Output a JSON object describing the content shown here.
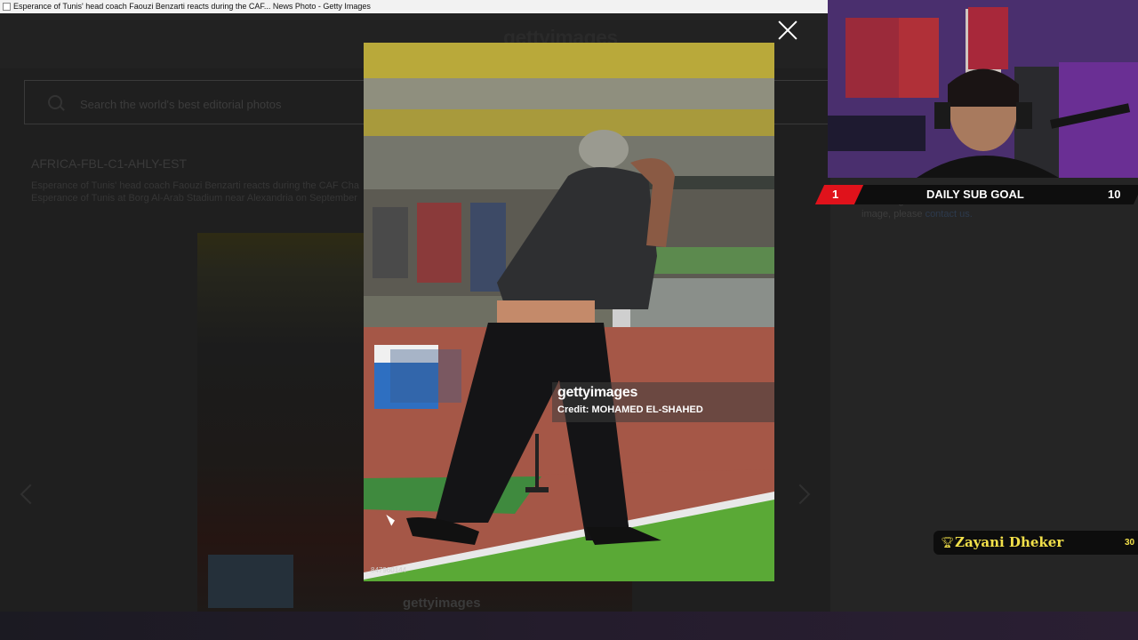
{
  "window": {
    "title": "Esperance of Tunis' head coach Faouzi Benzarti reacts during the CAF... News Photo - Getty Images"
  },
  "page": {
    "logo": "gettyimages",
    "search": {
      "placeholder": "Search the world's best editorial photos"
    },
    "photo_title": "AFRICA-FBL-C1-AHLY-EST",
    "description_line1": "Esperance of Tunis' head coach Faouzi Benzarti reacts during the CAF Cha",
    "description_line2": "Esperance of Tunis at Borg Al-Arab Stadium near Alexandria on September",
    "side_note": "This image cannot be licensed online. To license this image, please",
    "side_note_link": "contact us."
  },
  "lightbox": {
    "watermark_logo": "gettyimages",
    "credit": "Credit: MOHAMED EL-SHAHED",
    "photo_id": "847960144"
  },
  "overlay": {
    "sub_goal": {
      "current": "1",
      "label": "DAILY SUB GOAL",
      "target": "10"
    },
    "alert": {
      "name": "Zayani Dheker",
      "value": "30"
    }
  },
  "colors": {
    "accent_red": "#e0121b",
    "alert_gold": "#f2e04a"
  }
}
